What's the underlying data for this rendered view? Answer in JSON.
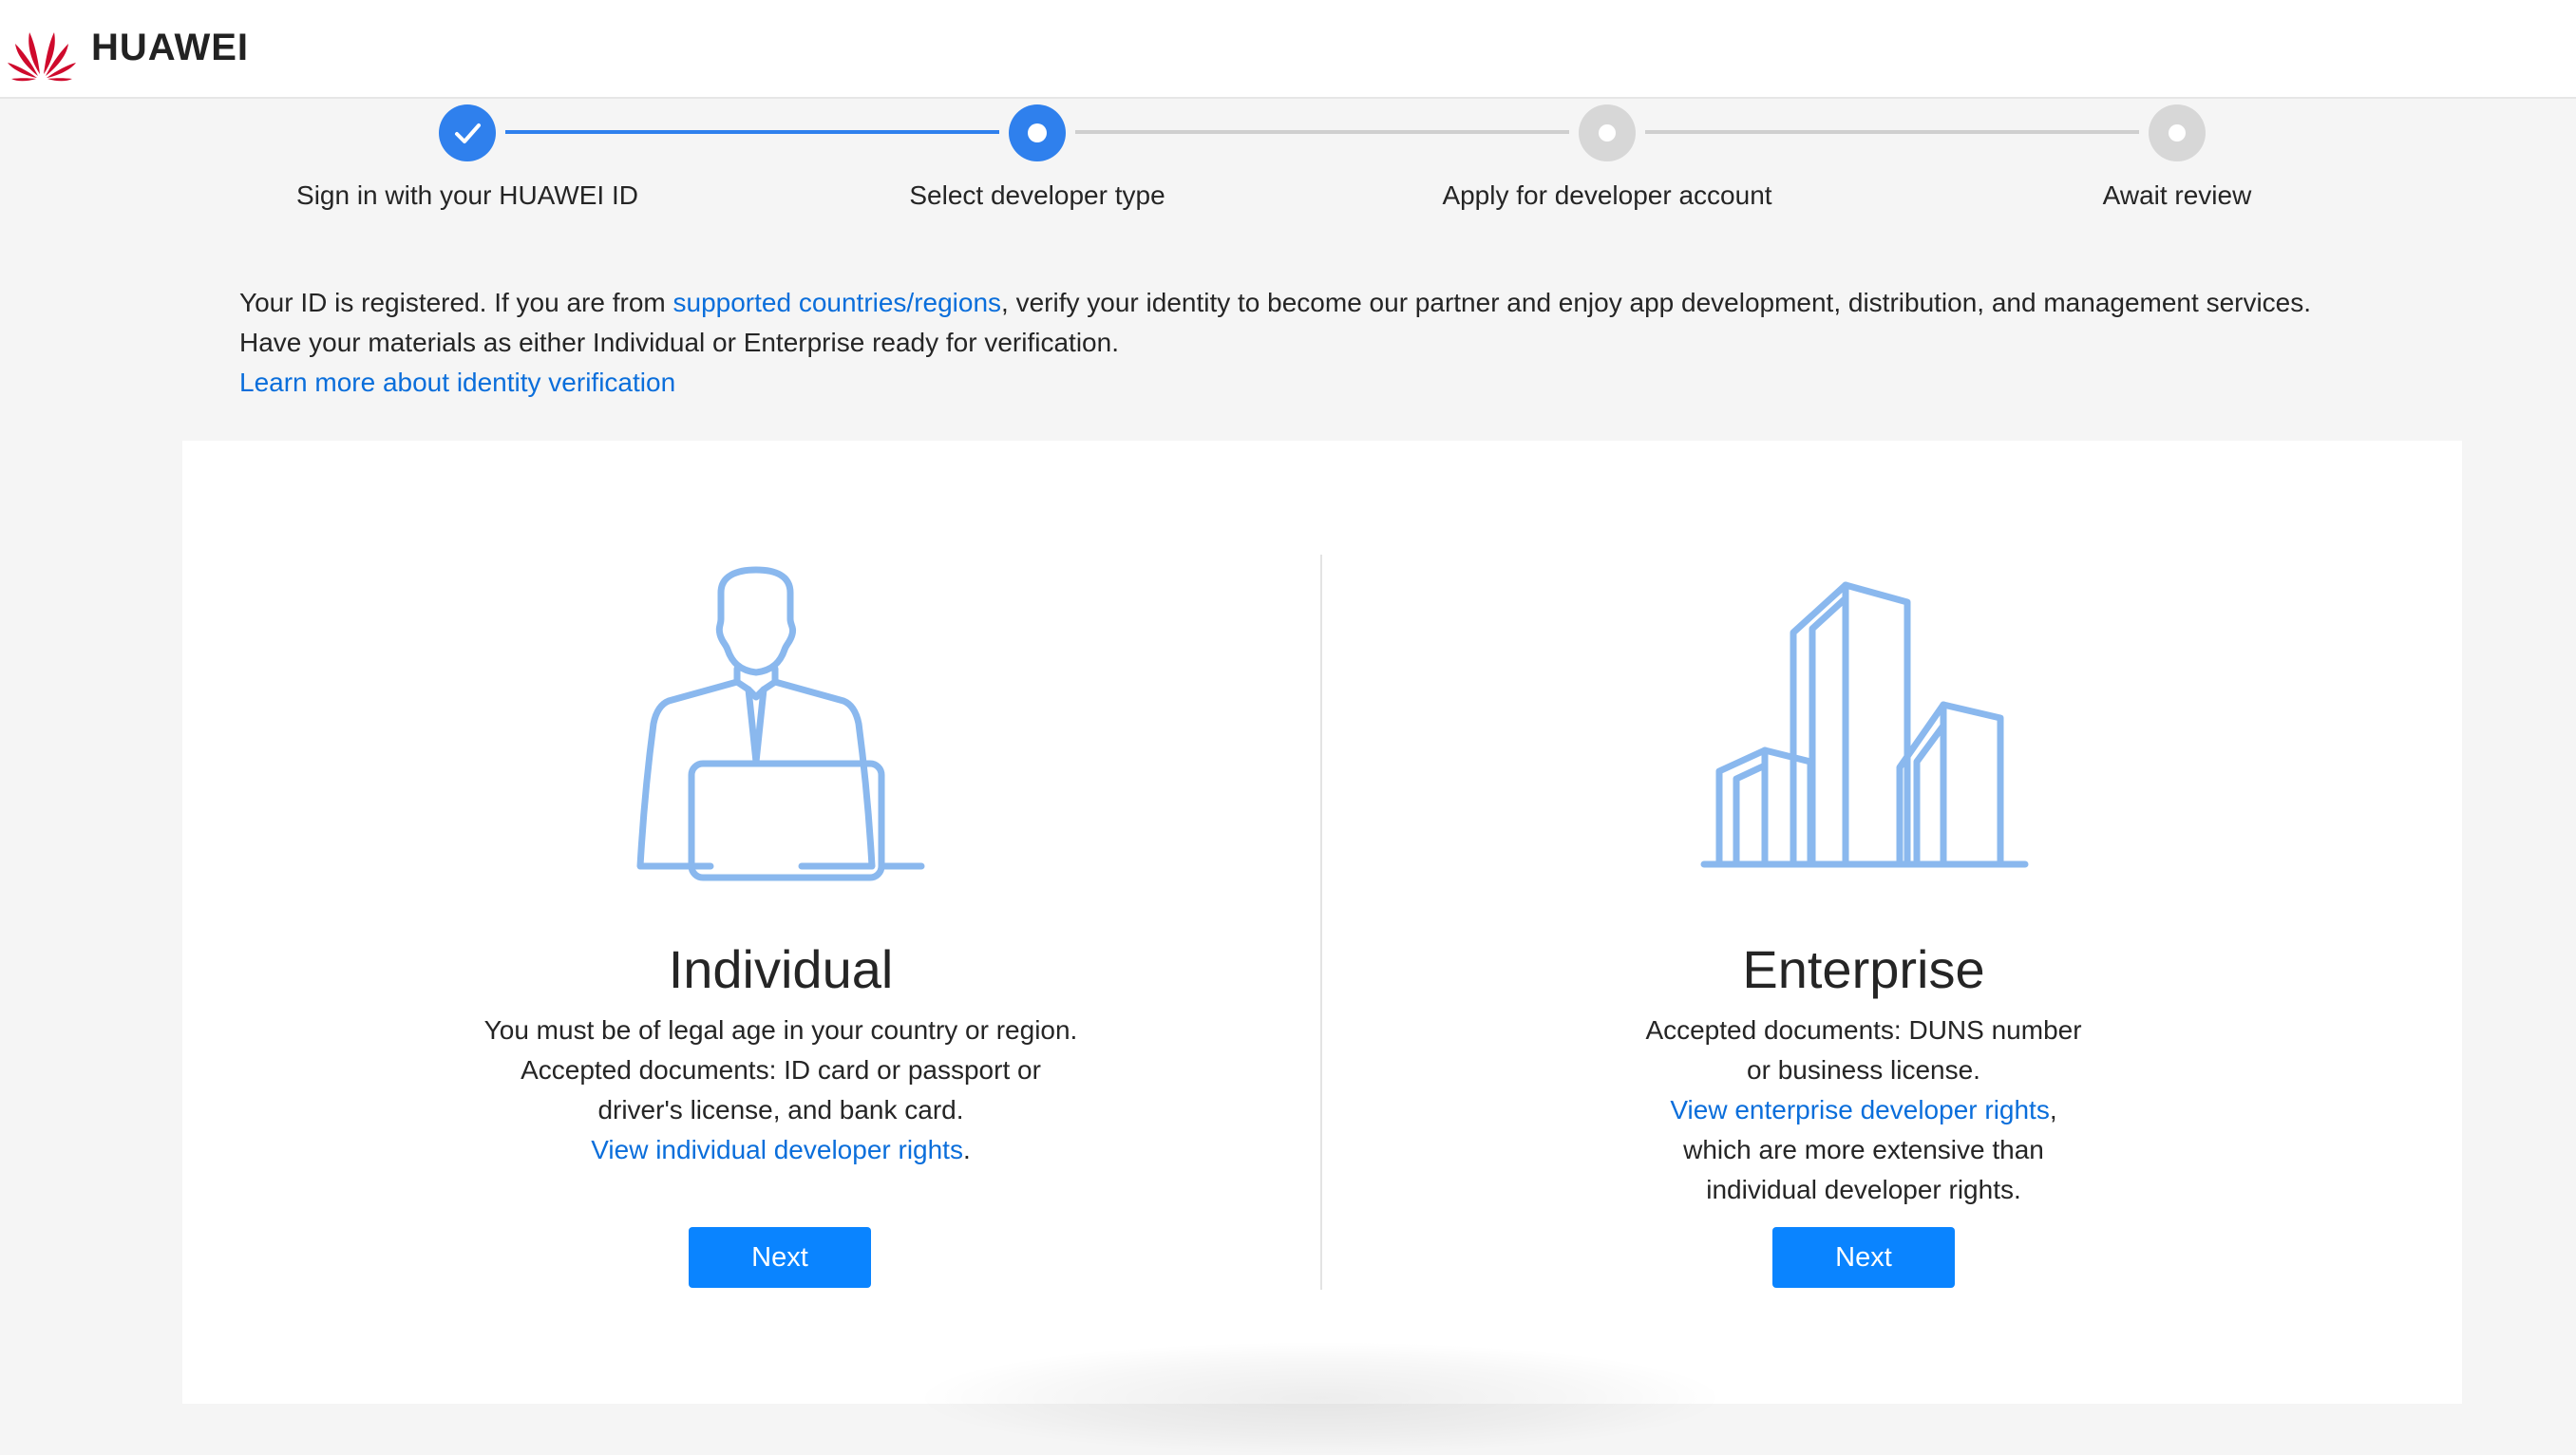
{
  "brand": {
    "name": "HUAWEI",
    "logo_icon": "huawei-flower-logo",
    "logo_color": "#cf0a2c"
  },
  "colors": {
    "accent": "#2f80ed",
    "button": "#0a84ff",
    "link": "#0a6edb",
    "illustration": "#8ab8ee"
  },
  "stepper": {
    "steps": [
      {
        "label": "Sign in with your HUAWEI ID",
        "state": "done"
      },
      {
        "label": "Select developer type",
        "state": "current"
      },
      {
        "label": "Apply for developer account",
        "state": "todo"
      },
      {
        "label": "Await review",
        "state": "todo"
      }
    ]
  },
  "intro": {
    "text_before_link": "Your ID is registered. If you are from ",
    "link_countries": "supported countries/regions",
    "text_after_link": ", verify your identity to become our partner and enjoy app development, distribution, and management services.",
    "line2": "Have your materials as either Individual or Enterprise ready for verification.",
    "learn_more_link": "Learn more about identity verification"
  },
  "individual": {
    "icon": "person-with-laptop-icon",
    "title": "Individual",
    "desc_line1": "You must be of legal age in your country or region.",
    "desc_line2": "Accepted documents: ID card or passport or driver's license, and bank card.",
    "rights_link": "View individual developer rights",
    "rights_suffix": ".",
    "next_label": "Next"
  },
  "enterprise": {
    "icon": "office-buildings-icon",
    "title": "Enterprise",
    "desc_line1": "Accepted documents: DUNS number or business license.",
    "rights_link": "View enterprise developer rights",
    "rights_suffix": ", which are more extensive than individual developer rights.",
    "next_label": "Next"
  }
}
